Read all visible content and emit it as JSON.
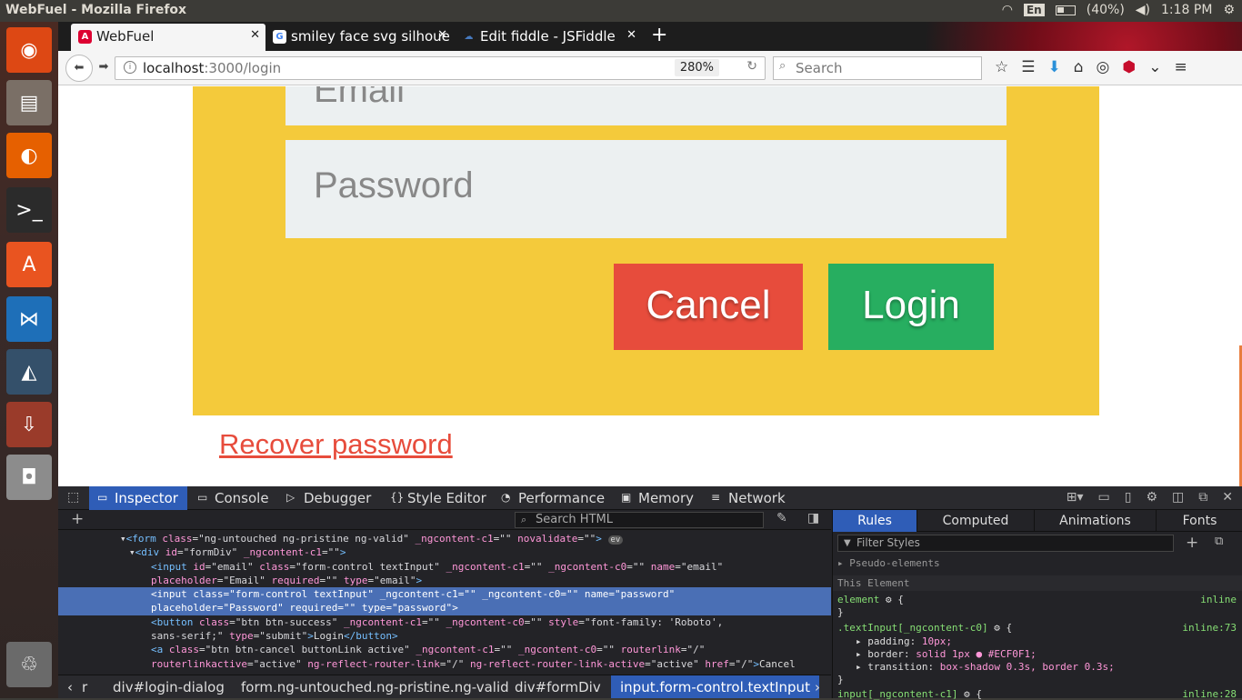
{
  "os": {
    "window_title": "WebFuel - Mozilla Firefox",
    "keyboard_layout": "En",
    "battery": "(40%)",
    "clock": "1:18 PM"
  },
  "launcher": {
    "apps": [
      {
        "name": "ubuntu-dash-icon",
        "color": "#dd4814",
        "glyph": "◉"
      },
      {
        "name": "files-icon",
        "color": "#7a6f66",
        "glyph": "▤"
      },
      {
        "name": "firefox-icon",
        "color": "#e66000",
        "glyph": "◐"
      },
      {
        "name": "terminal-icon",
        "color": "#2b2b2b",
        "glyph": ">_"
      },
      {
        "name": "software-center-icon",
        "color": "#e95420",
        "glyph": "A"
      },
      {
        "name": "vscode-icon",
        "color": "#1e6fb8",
        "glyph": "⋈"
      },
      {
        "name": "mysql-workbench-icon",
        "color": "#34506a",
        "glyph": "◭"
      },
      {
        "name": "installer-icon",
        "color": "#9a3b2a",
        "glyph": "⇩"
      },
      {
        "name": "camera-icon",
        "color": "#8c8c8c",
        "glyph": "◘"
      },
      {
        "name": "trash-icon",
        "color": "#6a6a6a",
        "glyph": "♲"
      }
    ]
  },
  "browser": {
    "tabs": [
      {
        "label": "WebFuel",
        "icon": "A",
        "icon_color": "#dd0031"
      },
      {
        "label": "smiley face svg silhoue",
        "icon": "G",
        "icon_color": "#4285f4"
      },
      {
        "label": "Edit fiddle - JSFiddle",
        "icon": "☁",
        "icon_color": "#4679bd"
      }
    ],
    "url_host": "localhost",
    "url_path": ":3000/login",
    "zoom": "280%",
    "search_placeholder": "Search"
  },
  "page": {
    "email_placeholder": "Email",
    "password_placeholder": "Password",
    "cancel_label": "Cancel",
    "login_label": "Login",
    "recover_link": "Recover password",
    "colors": {
      "dialog_bg": "#f4ca3b",
      "input_bg": "#ecf0f1",
      "cancel_bg": "#e74c3c",
      "login_bg": "#27ae60",
      "link": "#e74c3c"
    }
  },
  "devtools": {
    "tabs": [
      "Inspector",
      "Console",
      "Debugger",
      "Style Editor",
      "Performance",
      "Memory",
      "Network"
    ],
    "search_html_placeholder": "Search HTML",
    "breadcrumbs": [
      "r",
      "div#login-dialog",
      "form.ng-untouched.ng-pristine.ng-valid",
      "div#formDiv",
      "input.form-control.textInput"
    ],
    "rules_tabs": [
      "Rules",
      "Computed",
      "Animations",
      "Fonts"
    ],
    "filter_placeholder": "Filter Styles",
    "pseudo_elements": "Pseudo-elements",
    "this_element": "This Element",
    "element_source": "inline",
    "rule_selector": ".textInput[_ngcontent-c0]",
    "rule_source": "inline:73",
    "rule_props": [
      {
        "name": "padding",
        "value": "10px;"
      },
      {
        "name": "border",
        "value": "solid 1px ● #ECF0F1;"
      },
      {
        "name": "transition",
        "value": "box-shadow 0.3s, border 0.3s;"
      }
    ],
    "next_rule_selector": "input[_ngcontent-c1]",
    "next_rule_source": "inline:28"
  }
}
